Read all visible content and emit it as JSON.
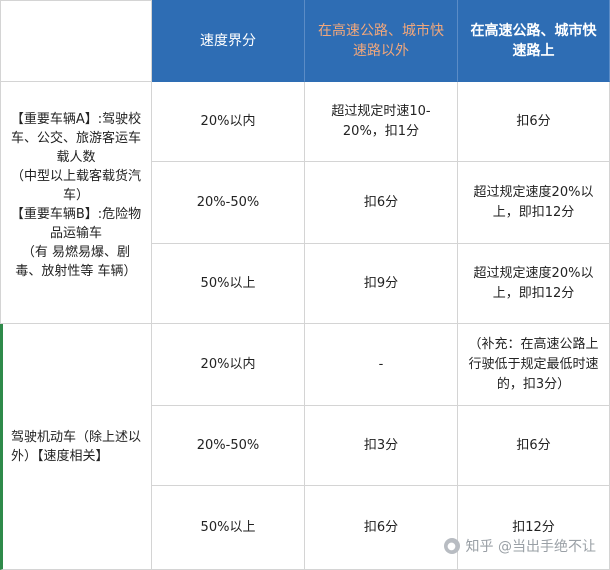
{
  "header": {
    "blank": "",
    "col1": "速度界分",
    "col2": "在高速公路、城市快速路以外",
    "col3": "在高速公路、城市快速路上"
  },
  "groups": [
    {
      "label": "【重要车辆A】:驾驶校车、公交、旅游客运车载人数\n（中型以上载客载货汽车）\n【重要车辆B】:危险物品运输车\n（有 易燃易爆、剧毒、放射性等 车辆）",
      "rows": [
        {
          "range": "20%以内",
          "outside": "超过规定时速10-20%，扣1分",
          "on": "扣6分"
        },
        {
          "range": "20%-50%",
          "outside": "扣6分",
          "on": "超过规定速度20%以上，即扣12分"
        },
        {
          "range": "50%以上",
          "outside": "扣9分",
          "on": "超过规定速度20%以上，即扣12分"
        }
      ]
    },
    {
      "label": "驾驶机动车（除上述以外）【速度相关】",
      "rows": [
        {
          "range": "20%以内",
          "outside": "-",
          "on": "（补充：在高速公路上行驶低于规定最低时速的，扣3分）"
        },
        {
          "range": "20%-50%",
          "outside": "扣3分",
          "on": "扣6分"
        },
        {
          "range": "50%以上",
          "outside": "扣6分",
          "on": "扣12分"
        }
      ]
    }
  ],
  "watermark": {
    "text": "知乎 @当出手绝不让",
    "icon": "zhihu-avatar-icon"
  },
  "colors": {
    "header_bg": "#2e6db4",
    "header_warm_text": "#f0a77c",
    "border": "#d4d4d4"
  }
}
